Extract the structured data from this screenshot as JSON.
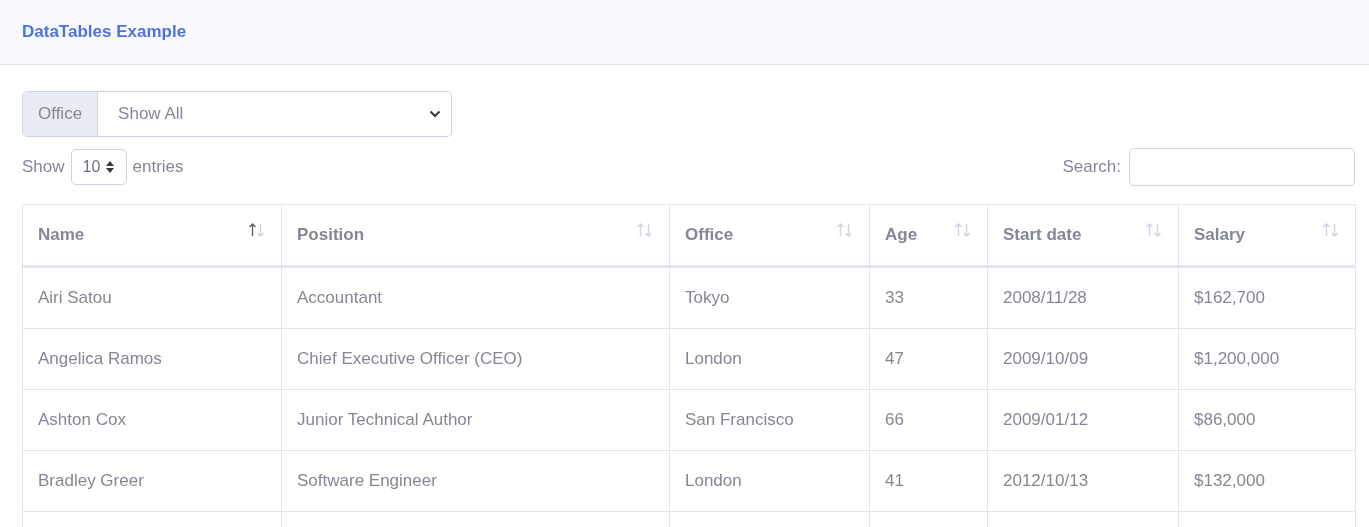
{
  "card": {
    "title": "DataTables Example"
  },
  "filter": {
    "label": "Office",
    "value": "Show All"
  },
  "length": {
    "before": "Show",
    "value": "10",
    "after": "entries"
  },
  "search": {
    "label": "Search:"
  },
  "table": {
    "columns": [
      {
        "label": "Name",
        "sorted": true
      },
      {
        "label": "Position",
        "sorted": false
      },
      {
        "label": "Office",
        "sorted": false
      },
      {
        "label": "Age",
        "sorted": false
      },
      {
        "label": "Start date",
        "sorted": false
      },
      {
        "label": "Salary",
        "sorted": false
      }
    ],
    "rows": [
      [
        "Airi Satou",
        "Accountant",
        "Tokyo",
        "33",
        "2008/11/28",
        "$162,700"
      ],
      [
        "Angelica Ramos",
        "Chief Executive Officer (CEO)",
        "London",
        "47",
        "2009/10/09",
        "$1,200,000"
      ],
      [
        "Ashton Cox",
        "Junior Technical Author",
        "San Francisco",
        "66",
        "2009/01/12",
        "$86,000"
      ],
      [
        "Bradley Greer",
        "Software Engineer",
        "London",
        "41",
        "2012/10/13",
        "$132,000"
      ]
    ]
  }
}
